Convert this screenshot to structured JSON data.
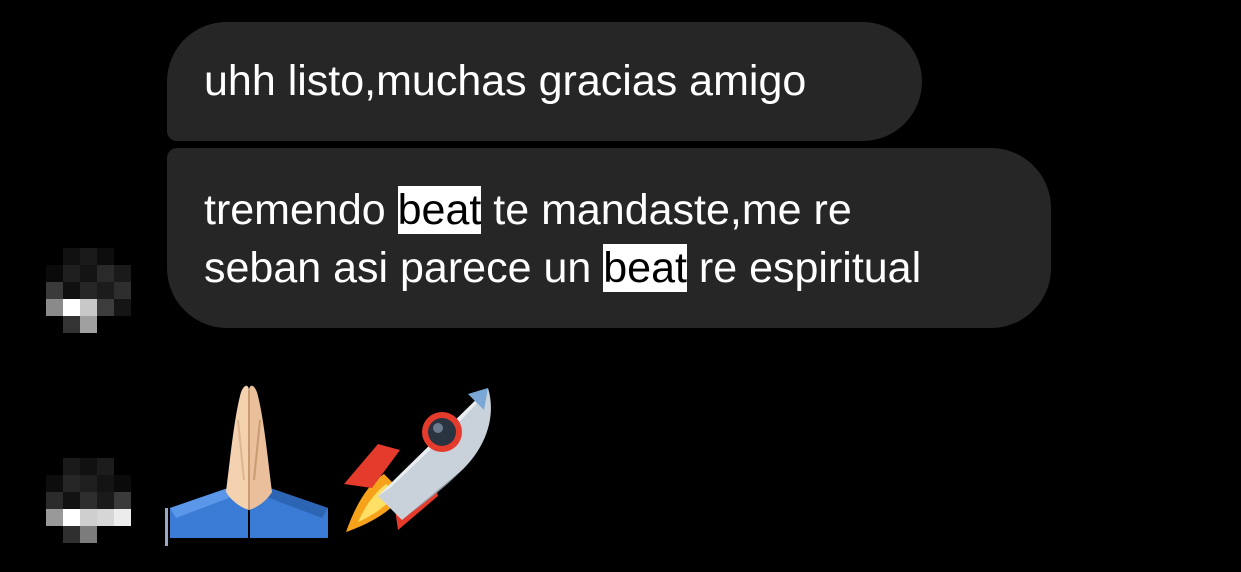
{
  "messages": [
    {
      "text": "uhh listo,muchas gracias amigo"
    },
    {
      "line1": {
        "before": "tremendo ",
        "highlight": "beat",
        "after": " te mandaste,me re"
      },
      "line2": {
        "before": "seban asi parece un ",
        "highlight": "beat",
        "after": " re espiritual"
      }
    }
  ],
  "emoji_message": {
    "emojis": [
      "folded-hands",
      "rocket"
    ]
  },
  "colors": {
    "background": "#000000",
    "bubble": "#262626",
    "text": "#ffffff",
    "highlight_bg": "#ffffff",
    "highlight_text": "#000000"
  }
}
